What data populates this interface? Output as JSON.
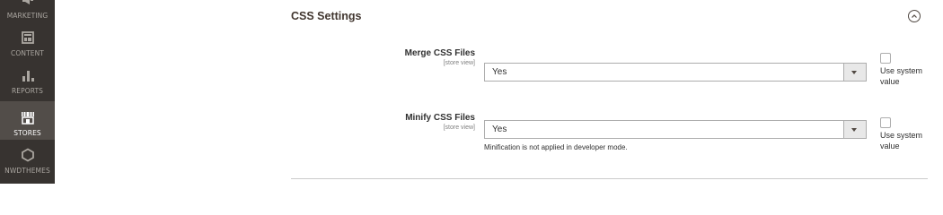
{
  "sidebar": {
    "items": [
      {
        "label": "MARKETING",
        "icon": "megaphone-icon"
      },
      {
        "label": "CONTENT",
        "icon": "layout-icon"
      },
      {
        "label": "REPORTS",
        "icon": "bar-chart-icon"
      },
      {
        "label": "STORES",
        "icon": "storefront-icon",
        "active": true
      },
      {
        "label": "NWDTHEMES",
        "icon": "hexagon-icon"
      }
    ]
  },
  "section": {
    "title": "CSS Settings"
  },
  "fields": [
    {
      "label": "Merge CSS Files",
      "scope": "[store view]",
      "value": "Yes",
      "use_system_value": "Use system value",
      "note": ""
    },
    {
      "label": "Minify CSS Files",
      "scope": "[store view]",
      "value": "Yes",
      "use_system_value": "Use system value",
      "note": "Minification is not applied in developer mode."
    }
  ],
  "colors": {
    "sidebar_bg": "#373330",
    "sidebar_active": "#524d49",
    "sidebar_text": "#aaa6a0"
  }
}
